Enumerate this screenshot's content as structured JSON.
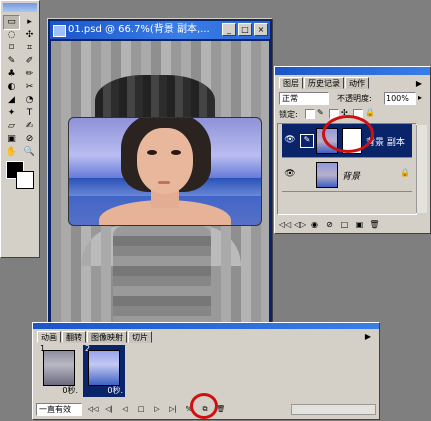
{
  "document": {
    "title": "01.psd @ 66.7%(背景 副本,...",
    "buttons": {
      "minimize": "_",
      "maximize": "□",
      "close": "×"
    }
  },
  "toolbox": {
    "tools": [
      "▭",
      "▸",
      "◌",
      "✣",
      "⌑",
      "⌗",
      "✎",
      "✐",
      "♣",
      "✏",
      "◐",
      "✂",
      "◢",
      "◔",
      "✦",
      "T",
      "▱",
      "✍",
      "▣",
      "⊘",
      "✋",
      "🔍"
    ]
  },
  "layers_panel": {
    "tabs": [
      "图层",
      "历史记录",
      "动作"
    ],
    "blend_mode": "正常",
    "opacity_label": "不透明度:",
    "opacity_value": "100%",
    "lock_label": "锁定:",
    "layers": [
      {
        "name": "背景 副本",
        "selected": true
      },
      {
        "name": "背景",
        "selected": false
      }
    ],
    "bottom_icons": [
      "◁◁",
      "◁▷",
      "◉",
      "⊘",
      "□",
      "▣",
      "🗑"
    ]
  },
  "animation_panel": {
    "tabs": [
      "动画",
      "翻转",
      "图像映射",
      "切片"
    ],
    "frames": [
      {
        "number": "1",
        "delay": "0秒."
      },
      {
        "number": "2",
        "delay": "0秒."
      }
    ],
    "loop_option": "一直有效",
    "controls": [
      "◁◁",
      "◁|",
      "◁",
      "□",
      "▷",
      "▷|",
      "%",
      "⧉",
      "🗑"
    ]
  }
}
